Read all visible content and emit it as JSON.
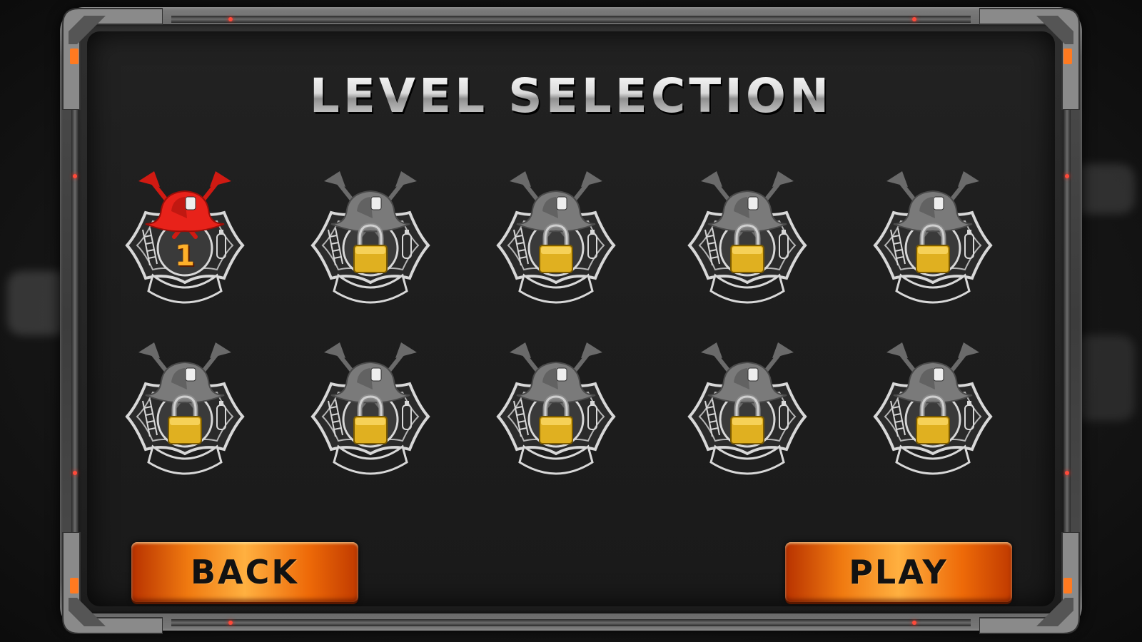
{
  "screen": {
    "title": "LEVEL SELECTION"
  },
  "colors": {
    "accent_orange": "#f07a10",
    "helmet_red": "#e8221a",
    "lock_gold": "#e0b020",
    "badge_silver": "#d8d8d8",
    "panel_bg": "#1e1e1e"
  },
  "levels": [
    {
      "label": "1",
      "status": "unlocked",
      "icon": "fire-helmet-badge-red"
    },
    {
      "label": "",
      "status": "locked",
      "icon": "padlock-icon"
    },
    {
      "label": "",
      "status": "locked",
      "icon": "padlock-icon"
    },
    {
      "label": "",
      "status": "locked",
      "icon": "padlock-icon"
    },
    {
      "label": "",
      "status": "locked",
      "icon": "padlock-icon"
    },
    {
      "label": "",
      "status": "locked",
      "icon": "padlock-icon"
    },
    {
      "label": "",
      "status": "locked",
      "icon": "padlock-icon"
    },
    {
      "label": "",
      "status": "locked",
      "icon": "padlock-icon"
    },
    {
      "label": "",
      "status": "locked",
      "icon": "padlock-icon"
    },
    {
      "label": "",
      "status": "locked",
      "icon": "padlock-icon"
    }
  ],
  "buttons": {
    "back": "BACK",
    "play": "PLAY"
  }
}
